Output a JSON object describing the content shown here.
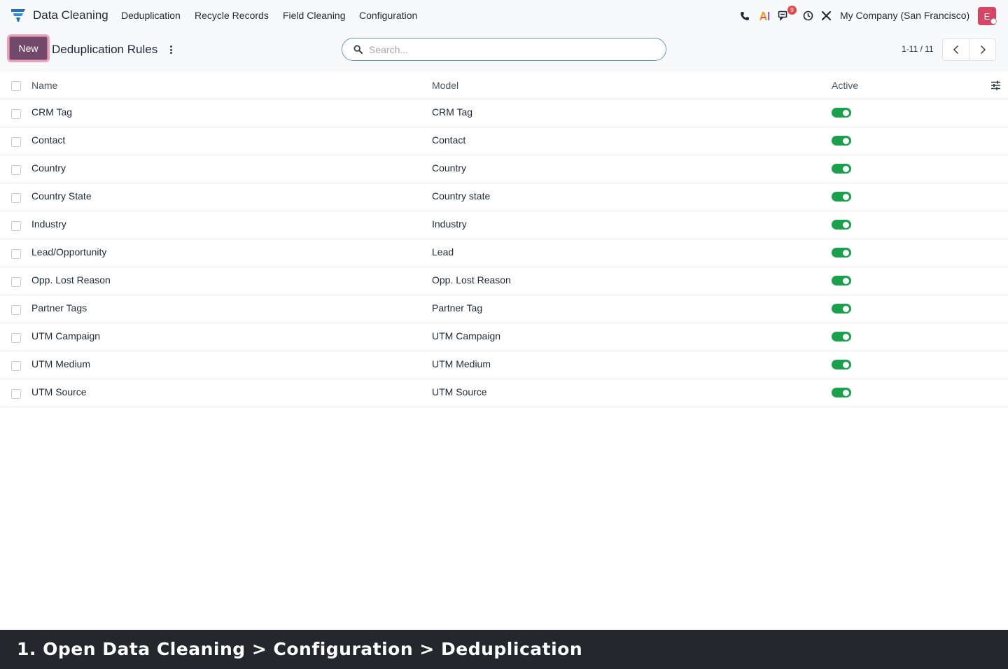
{
  "navbar": {
    "app_name": "Data Cleaning",
    "menu": [
      "Deduplication",
      "Recycle Records",
      "Field Cleaning",
      "Configuration"
    ],
    "systray": {
      "icons": [
        "phone-icon",
        "ai-icon",
        "messages-icon",
        "activity-clock-icon",
        "tools-icon"
      ],
      "messages_badge": "9",
      "company": "My Company (San Francisco)",
      "avatar_letter": "E"
    }
  },
  "control_panel": {
    "new_label": "New",
    "title": "Deduplication Rules",
    "search_placeholder": "Search...",
    "pager": "1-11 / 11"
  },
  "table": {
    "columns": [
      "Name",
      "Model",
      "Active"
    ],
    "rows": [
      {
        "name": "CRM Tag",
        "model": "CRM Tag",
        "active": true
      },
      {
        "name": "Contact",
        "model": "Contact",
        "active": true
      },
      {
        "name": "Country",
        "model": "Country",
        "active": true
      },
      {
        "name": "Country State",
        "model": "Country state",
        "active": true
      },
      {
        "name": "Industry",
        "model": "Industry",
        "active": true
      },
      {
        "name": "Lead/Opportunity",
        "model": "Lead",
        "active": true
      },
      {
        "name": "Opp. Lost Reason",
        "model": "Opp. Lost Reason",
        "active": true
      },
      {
        "name": "Partner Tags",
        "model": "Partner Tag",
        "active": true
      },
      {
        "name": "UTM Campaign",
        "model": "UTM Campaign",
        "active": true
      },
      {
        "name": "UTM Medium",
        "model": "UTM Medium",
        "active": true
      },
      {
        "name": "UTM Source",
        "model": "UTM Source",
        "active": true
      }
    ]
  },
  "caption": "1. Open Data Cleaning > Configuration > Deduplication",
  "colors": {
    "brand": "#71496a",
    "toggle_on": "#1aa14c",
    "caption_bg": "#24272b",
    "avatar": "#d64564"
  }
}
